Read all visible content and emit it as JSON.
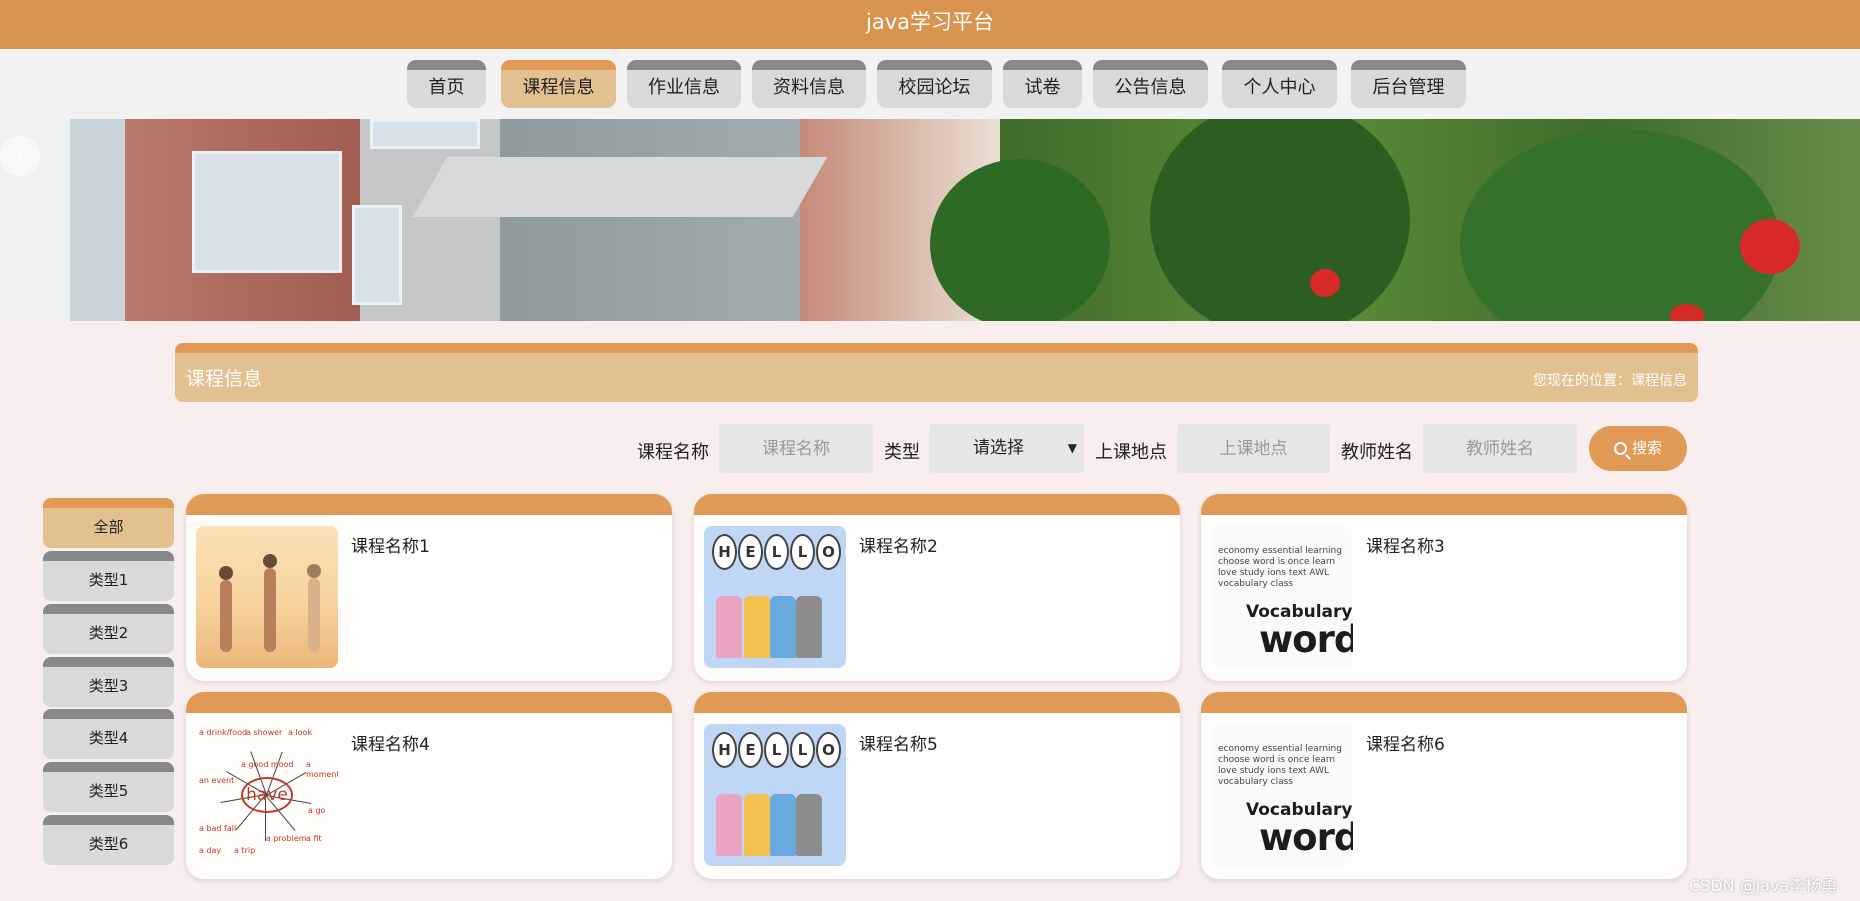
{
  "app": {
    "title": "java学习平台"
  },
  "nav": {
    "items": [
      {
        "label": "首页",
        "active": false
      },
      {
        "label": "课程信息",
        "active": true
      },
      {
        "label": "作业信息",
        "active": false
      },
      {
        "label": "资料信息",
        "active": false
      },
      {
        "label": "校园论坛",
        "active": false
      },
      {
        "label": "试卷",
        "active": false
      },
      {
        "label": "公告信息",
        "active": false
      },
      {
        "label": "个人中心",
        "active": false
      },
      {
        "label": "后台管理",
        "active": false
      }
    ]
  },
  "banner": {
    "prev_arrow": "‹",
    "prev_icon": "chevron-left-icon"
  },
  "section": {
    "title": "课程信息",
    "breadcrumb": "您现在的位置：课程信息"
  },
  "search": {
    "course_name_label": "课程名称",
    "course_name_placeholder": "课程名称",
    "type_label": "类型",
    "type_selected": "请选择",
    "location_label": "上课地点",
    "location_placeholder": "上课地点",
    "teacher_label": "教师姓名",
    "teacher_placeholder": "教师姓名",
    "button_label": "搜索",
    "button_icon": "search-icon"
  },
  "sidebar": {
    "items": [
      {
        "label": "全部",
        "active": true
      },
      {
        "label": "类型1",
        "active": false
      },
      {
        "label": "类型2",
        "active": false
      },
      {
        "label": "类型3",
        "active": false
      },
      {
        "label": "类型4",
        "active": false
      },
      {
        "label": "类型5",
        "active": false
      },
      {
        "label": "类型6",
        "active": false
      }
    ]
  },
  "courses": [
    {
      "title": "课程名称1",
      "thumb": "yoga-photo"
    },
    {
      "title": "课程名称2",
      "thumb": "hello-kids-illustration"
    },
    {
      "title": "课程名称3",
      "thumb": "vocabulary-words-cloud"
    },
    {
      "title": "课程名称4",
      "thumb": "have-mindmap"
    },
    {
      "title": "课程名称5",
      "thumb": "hello-kids-illustration"
    },
    {
      "title": "课程名称6",
      "thumb": "vocabulary-words-cloud"
    }
  ],
  "hello_letters": [
    "H",
    "E",
    "L",
    "L",
    "O"
  ],
  "word_cloud": {
    "small": "economy essential learning choose word is once learn love study ions text AWL vocabulary class",
    "mid": "Vocabulary",
    "big": "words"
  },
  "have_diagram": {
    "center": "have",
    "labels": [
      "a drink/food",
      "a shower",
      "a look",
      "a good mood",
      "an event",
      "a bad fall",
      "a trip",
      "a problem",
      "a moment",
      "a go",
      "a fit",
      "a day"
    ]
  },
  "watermark": "CSDN @java李杨勇",
  "colors": {
    "primary": "#d8934f",
    "accent": "#e09a55",
    "active_fill": "#e3c08f",
    "inactive_fill": "#d9d9d9",
    "background": "#f8eeee"
  }
}
